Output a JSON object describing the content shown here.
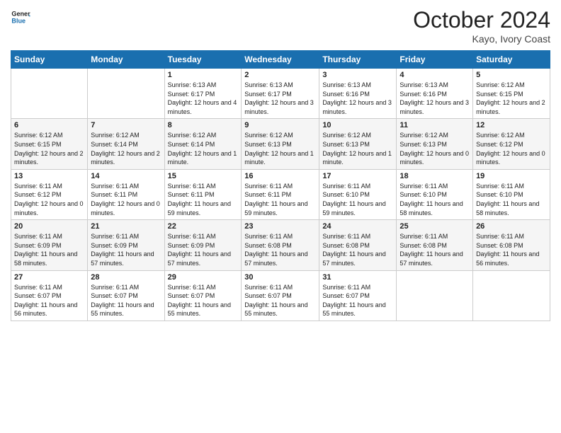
{
  "header": {
    "logo_line1": "General",
    "logo_line2": "Blue",
    "month": "October 2024",
    "location": "Kayo, Ivory Coast"
  },
  "days_of_week": [
    "Sunday",
    "Monday",
    "Tuesday",
    "Wednesday",
    "Thursday",
    "Friday",
    "Saturday"
  ],
  "weeks": [
    [
      {
        "day": "",
        "info": ""
      },
      {
        "day": "",
        "info": ""
      },
      {
        "day": "1",
        "info": "Sunrise: 6:13 AM\nSunset: 6:17 PM\nDaylight: 12 hours and 4 minutes."
      },
      {
        "day": "2",
        "info": "Sunrise: 6:13 AM\nSunset: 6:17 PM\nDaylight: 12 hours and 3 minutes."
      },
      {
        "day": "3",
        "info": "Sunrise: 6:13 AM\nSunset: 6:16 PM\nDaylight: 12 hours and 3 minutes."
      },
      {
        "day": "4",
        "info": "Sunrise: 6:13 AM\nSunset: 6:16 PM\nDaylight: 12 hours and 3 minutes."
      },
      {
        "day": "5",
        "info": "Sunrise: 6:12 AM\nSunset: 6:15 PM\nDaylight: 12 hours and 2 minutes."
      }
    ],
    [
      {
        "day": "6",
        "info": "Sunrise: 6:12 AM\nSunset: 6:15 PM\nDaylight: 12 hours and 2 minutes."
      },
      {
        "day": "7",
        "info": "Sunrise: 6:12 AM\nSunset: 6:14 PM\nDaylight: 12 hours and 2 minutes."
      },
      {
        "day": "8",
        "info": "Sunrise: 6:12 AM\nSunset: 6:14 PM\nDaylight: 12 hours and 1 minute."
      },
      {
        "day": "9",
        "info": "Sunrise: 6:12 AM\nSunset: 6:13 PM\nDaylight: 12 hours and 1 minute."
      },
      {
        "day": "10",
        "info": "Sunrise: 6:12 AM\nSunset: 6:13 PM\nDaylight: 12 hours and 1 minute."
      },
      {
        "day": "11",
        "info": "Sunrise: 6:12 AM\nSunset: 6:13 PM\nDaylight: 12 hours and 0 minutes."
      },
      {
        "day": "12",
        "info": "Sunrise: 6:12 AM\nSunset: 6:12 PM\nDaylight: 12 hours and 0 minutes."
      }
    ],
    [
      {
        "day": "13",
        "info": "Sunrise: 6:11 AM\nSunset: 6:12 PM\nDaylight: 12 hours and 0 minutes."
      },
      {
        "day": "14",
        "info": "Sunrise: 6:11 AM\nSunset: 6:11 PM\nDaylight: 12 hours and 0 minutes."
      },
      {
        "day": "15",
        "info": "Sunrise: 6:11 AM\nSunset: 6:11 PM\nDaylight: 11 hours and 59 minutes."
      },
      {
        "day": "16",
        "info": "Sunrise: 6:11 AM\nSunset: 6:11 PM\nDaylight: 11 hours and 59 minutes."
      },
      {
        "day": "17",
        "info": "Sunrise: 6:11 AM\nSunset: 6:10 PM\nDaylight: 11 hours and 59 minutes."
      },
      {
        "day": "18",
        "info": "Sunrise: 6:11 AM\nSunset: 6:10 PM\nDaylight: 11 hours and 58 minutes."
      },
      {
        "day": "19",
        "info": "Sunrise: 6:11 AM\nSunset: 6:10 PM\nDaylight: 11 hours and 58 minutes."
      }
    ],
    [
      {
        "day": "20",
        "info": "Sunrise: 6:11 AM\nSunset: 6:09 PM\nDaylight: 11 hours and 58 minutes."
      },
      {
        "day": "21",
        "info": "Sunrise: 6:11 AM\nSunset: 6:09 PM\nDaylight: 11 hours and 57 minutes."
      },
      {
        "day": "22",
        "info": "Sunrise: 6:11 AM\nSunset: 6:09 PM\nDaylight: 11 hours and 57 minutes."
      },
      {
        "day": "23",
        "info": "Sunrise: 6:11 AM\nSunset: 6:08 PM\nDaylight: 11 hours and 57 minutes."
      },
      {
        "day": "24",
        "info": "Sunrise: 6:11 AM\nSunset: 6:08 PM\nDaylight: 11 hours and 57 minutes."
      },
      {
        "day": "25",
        "info": "Sunrise: 6:11 AM\nSunset: 6:08 PM\nDaylight: 11 hours and 57 minutes."
      },
      {
        "day": "26",
        "info": "Sunrise: 6:11 AM\nSunset: 6:08 PM\nDaylight: 11 hours and 56 minutes."
      }
    ],
    [
      {
        "day": "27",
        "info": "Sunrise: 6:11 AM\nSunset: 6:07 PM\nDaylight: 11 hours and 56 minutes."
      },
      {
        "day": "28",
        "info": "Sunrise: 6:11 AM\nSunset: 6:07 PM\nDaylight: 11 hours and 55 minutes."
      },
      {
        "day": "29",
        "info": "Sunrise: 6:11 AM\nSunset: 6:07 PM\nDaylight: 11 hours and 55 minutes."
      },
      {
        "day": "30",
        "info": "Sunrise: 6:11 AM\nSunset: 6:07 PM\nDaylight: 11 hours and 55 minutes."
      },
      {
        "day": "31",
        "info": "Sunrise: 6:11 AM\nSunset: 6:07 PM\nDaylight: 11 hours and 55 minutes."
      },
      {
        "day": "",
        "info": ""
      },
      {
        "day": "",
        "info": ""
      }
    ]
  ]
}
